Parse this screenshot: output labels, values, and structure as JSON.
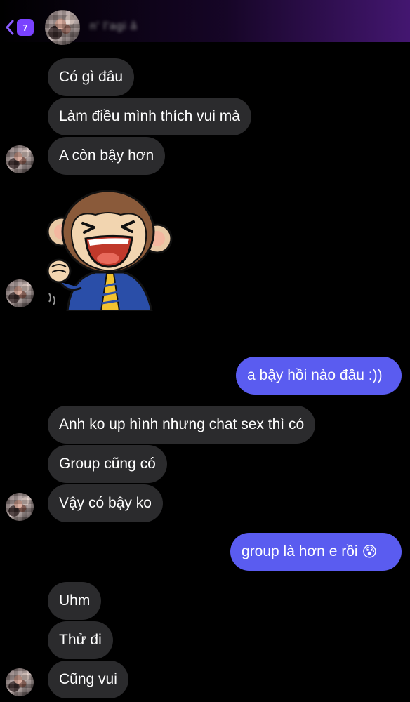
{
  "header": {
    "unread_count": "7",
    "contact_name": "n' l'agi ả"
  },
  "messages": [
    {
      "side": "in",
      "text": "Có gì đâu"
    },
    {
      "side": "in",
      "text": "Làm điều mình thích vui mà"
    },
    {
      "side": "in",
      "text": "A còn bậy hơn"
    },
    {
      "side": "in",
      "sticker": "laughing-monkey-sticker"
    },
    {
      "side": "out",
      "text": "a bậy hồi nào đâu :))"
    },
    {
      "side": "in",
      "text": "Anh ko up hình nhưng chat sex thì có"
    },
    {
      "side": "in",
      "text": "Group cũng có"
    },
    {
      "side": "in",
      "text": "Vậy có bậy ko"
    },
    {
      "side": "out",
      "text": "group là hơn e rồi",
      "emoji": "😰"
    },
    {
      "side": "in",
      "text": "Uhm"
    },
    {
      "side": "in",
      "text": "Thử đi"
    },
    {
      "side": "in",
      "text": "Cũng vui"
    }
  ],
  "colors": {
    "incoming_bubble": "#2b2b2d",
    "outgoing_bubble": "#5a5cf0",
    "badge": "#7a42ff",
    "background": "#000000"
  }
}
